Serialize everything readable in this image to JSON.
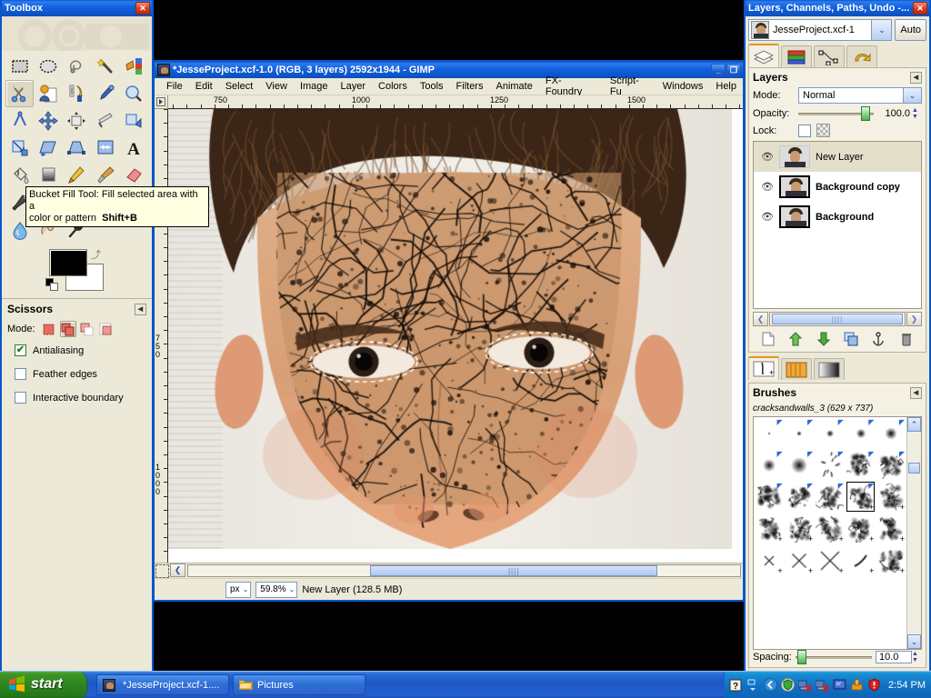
{
  "toolbox": {
    "title": "Toolbox",
    "close_label": "✕",
    "tools": [
      {
        "name": "rect-select-tool",
        "tip": "Rectangle Select"
      },
      {
        "name": "ellipse-select-tool",
        "tip": "Ellipse Select"
      },
      {
        "name": "free-select-tool",
        "tip": "Free Select"
      },
      {
        "name": "fuzzy-select-tool",
        "tip": "Fuzzy Select"
      },
      {
        "name": "select-by-color-tool",
        "tip": "Select By Color"
      },
      {
        "name": "scissors-select-tool",
        "tip": "Intelligent Scissors"
      },
      {
        "name": "foreground-select-tool",
        "tip": "Foreground Select"
      },
      {
        "name": "paths-tool",
        "tip": "Paths"
      },
      {
        "name": "color-picker-tool",
        "tip": "Color Picker"
      },
      {
        "name": "zoom-tool",
        "tip": "Zoom"
      },
      {
        "name": "measure-tool",
        "tip": "Measure"
      },
      {
        "name": "move-tool",
        "tip": "Move"
      },
      {
        "name": "align-tool",
        "tip": "Alignment"
      },
      {
        "name": "crop-tool",
        "tip": "Crop"
      },
      {
        "name": "rotate-tool",
        "tip": "Rotate"
      },
      {
        "name": "scale-tool",
        "tip": "Scale"
      },
      {
        "name": "shear-tool",
        "tip": "Shear"
      },
      {
        "name": "perspective-tool",
        "tip": "Perspective"
      },
      {
        "name": "flip-tool",
        "tip": "Flip"
      },
      {
        "name": "text-tool",
        "tip": "Text"
      },
      {
        "name": "bucket-fill-tool",
        "tip": "Bucket Fill"
      },
      {
        "name": "blend-tool",
        "tip": "Blend"
      },
      {
        "name": "pencil-tool",
        "tip": "Pencil"
      },
      {
        "name": "paintbrush-tool",
        "tip": "Paintbrush"
      },
      {
        "name": "eraser-tool",
        "tip": "Eraser"
      },
      {
        "name": "airbrush-tool",
        "tip": "Airbrush"
      },
      {
        "name": "ink-tool",
        "tip": "Ink"
      },
      {
        "name": "clone-tool",
        "tip": "Clone"
      },
      {
        "name": "healing-tool",
        "tip": "Heal"
      },
      {
        "name": "perspective-clone-tool",
        "tip": "Perspective Clone"
      },
      {
        "name": "blur-sharpen-tool",
        "tip": "Blur / Sharpen"
      },
      {
        "name": "smudge-tool",
        "tip": "Smudge"
      },
      {
        "name": "dodge-burn-tool",
        "tip": "Dodge / Burn"
      }
    ],
    "active_tool_index": 5,
    "foreground_color": "#000000",
    "background_color": "#ffffff"
  },
  "tooltip": {
    "line1": "Bucket Fill Tool: Fill selected area with a",
    "line2": "color or pattern",
    "shortcut": "Shift+B"
  },
  "tool_options": {
    "title": "Scissors",
    "collapse_icon": "◀",
    "mode_label": "Mode:",
    "modes": [
      "replace",
      "add",
      "subtract",
      "intersect"
    ],
    "selected_mode_index": 1,
    "checkboxes": [
      {
        "label": "Antialiasing",
        "checked": true
      },
      {
        "label": "Feather edges",
        "checked": false
      },
      {
        "label": "Interactive boundary",
        "checked": false
      }
    ]
  },
  "image_window": {
    "title": "*JesseProject.xcf-1.0 (RGB, 3 layers) 2592x1944 - GIMP",
    "minimize_label": "_",
    "maximize_label": "❐",
    "menus": [
      "File",
      "Edit",
      "Select",
      "View",
      "Image",
      "Layer",
      "Colors",
      "Tools",
      "Filters",
      "Animate",
      "FX-Foundry",
      "Script-Fu",
      "Windows",
      "Help"
    ],
    "hruler_labels": [
      "750",
      "1000",
      "1250",
      "1500"
    ],
    "vruler_labels": [
      "750",
      "1000"
    ],
    "statusbar": {
      "unit": "px",
      "unit_arrow": "⌄",
      "zoom": "59.8%",
      "zoom_arrow": "⌄",
      "message": "New Layer (128.5 MB)"
    },
    "qmask_name": "quick-mask-toggle",
    "nav_arrow": "❮"
  },
  "layers_dock": {
    "title": "Layers, Channels, Paths, Undo -...",
    "close_label": "✕",
    "image_name": "JesseProject.xcf-1",
    "auto_label": "Auto",
    "dropdown_arrow": "⌄",
    "tabs": [
      "layers-tab",
      "channels-tab",
      "paths-tab",
      "undo-history-tab"
    ],
    "selected_tab_index": 0,
    "panel_title": "Layers",
    "collapse_icon": "◀",
    "mode_label": "Mode:",
    "mode_value": "Normal",
    "opacity_label": "Opacity:",
    "opacity_value": "100.0",
    "lock_label": "Lock:",
    "layers": [
      {
        "name": "New Layer",
        "visible": true,
        "selected": true,
        "bold": false
      },
      {
        "name": "Background copy",
        "visible": true,
        "selected": false,
        "bold": true
      },
      {
        "name": "Background",
        "visible": true,
        "selected": false,
        "bold": true
      }
    ],
    "eye_icon": "👁",
    "buttons": [
      "new-layer-button",
      "raise-layer-button",
      "lower-layer-button",
      "duplicate-layer-button",
      "anchor-layer-button",
      "delete-layer-button"
    ],
    "scroll_left": "❮",
    "scroll_right": "❯"
  },
  "brushes_dock": {
    "tabs": [
      "brushes-tab",
      "patterns-tab",
      "gradients-tab"
    ],
    "selected_tab_index": 0,
    "panel_title": "Brushes",
    "collapse_icon": "◀",
    "selected_brush": "cracksandwalls_3 (629 x 737)",
    "spacing_label": "Spacing:",
    "spacing_value": "10.0",
    "scroll_up": "⌃",
    "scroll_down": "⌄"
  },
  "taskbar": {
    "start_label": "start",
    "buttons": [
      {
        "label": "*JesseProject.xcf-1....",
        "icon": "gimp-icon",
        "active": true
      },
      {
        "label": "Pictures",
        "icon": "folder-icon",
        "active": false
      }
    ],
    "tray_icons": [
      "help-icon",
      "show-hidden-icon",
      "chevron-left-icon",
      "shield-icon",
      "network-disconnected-icon",
      "network-disconnected2-icon",
      "display-icon",
      "update-icon",
      "security-alert-icon"
    ],
    "clock": "2:54 PM"
  }
}
